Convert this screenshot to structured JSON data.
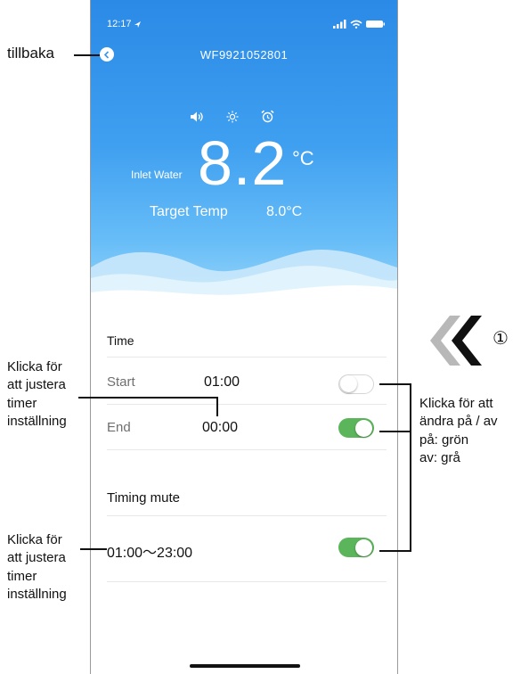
{
  "status_bar": {
    "time": "12:17"
  },
  "header": {
    "device_id": "WF9921052801"
  },
  "hero": {
    "inlet_label": "Inlet Water",
    "temperature": "8.2",
    "unit": "°C",
    "target_label": "Target Temp",
    "target_value": "8.0°C"
  },
  "time_section": {
    "title": "Time",
    "rows": [
      {
        "label": "Start",
        "value": "01:00",
        "enabled": false
      },
      {
        "label": "End",
        "value": "00:00",
        "enabled": true
      }
    ]
  },
  "mute_section": {
    "title": "Timing mute",
    "range": "01:00～23:00",
    "enabled": true
  },
  "annotations": {
    "back": "tillbaka",
    "adjust_timer_1": [
      "Klicka för",
      "att justera",
      "timer",
      "inställning"
    ],
    "adjust_timer_2": [
      "Klicka för",
      "att justera",
      "timer",
      "inställning"
    ],
    "toggle_help": [
      "Klicka för att",
      "ändra på / av",
      "på: grön",
      "av: grå"
    ],
    "step_number": "①"
  },
  "colors": {
    "toggle_on": "#5bb55a",
    "toggle_off": "#ffffff",
    "hero_top": "#2a8ae6",
    "hero_bottom": "#a5dcfb"
  }
}
